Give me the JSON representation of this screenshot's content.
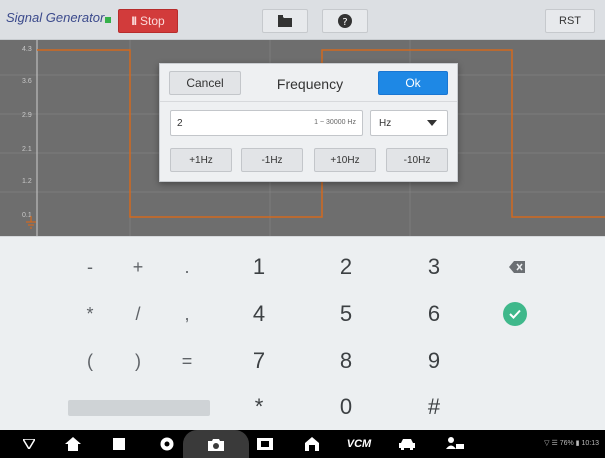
{
  "header": {
    "app_title": "Signal Generator",
    "stop_label": "Stop",
    "pause_glyph": "II",
    "folder_icon": "folder-icon",
    "help_icon": "help-icon",
    "rst_label": "RST"
  },
  "plot": {
    "y_ticks": [
      "4.3",
      "3.6",
      "2.9",
      "2.1",
      "1.2",
      "0.1"
    ],
    "trace_color": "#d2691e"
  },
  "dialog": {
    "cancel_label": "Cancel",
    "title": "Frequency",
    "ok_label": "Ok",
    "value": "2",
    "range_hint": "1 ~ 30000 Hz",
    "unit": "Hz",
    "steps": [
      "+1Hz",
      "-1Hz",
      "+10Hz",
      "-10Hz"
    ]
  },
  "keypad": {
    "rows": [
      [
        "-",
        "+",
        ".",
        "1",
        "2",
        "3"
      ],
      [
        "*",
        "/",
        ",",
        "4",
        "5",
        "6"
      ],
      [
        "(",
        ")",
        "=",
        "7",
        "8",
        "9"
      ],
      [
        "*",
        "0",
        "#"
      ]
    ],
    "backspace_icon": "backspace-icon",
    "enter_icon": "check-icon"
  },
  "navbar": {
    "vcm_label": "VCM",
    "status": "▽ ☰ 76% ▮ 10:13"
  },
  "colors": {
    "accent": "#1e88e5",
    "stop": "#d23b3b",
    "enter": "#3fb88b"
  }
}
